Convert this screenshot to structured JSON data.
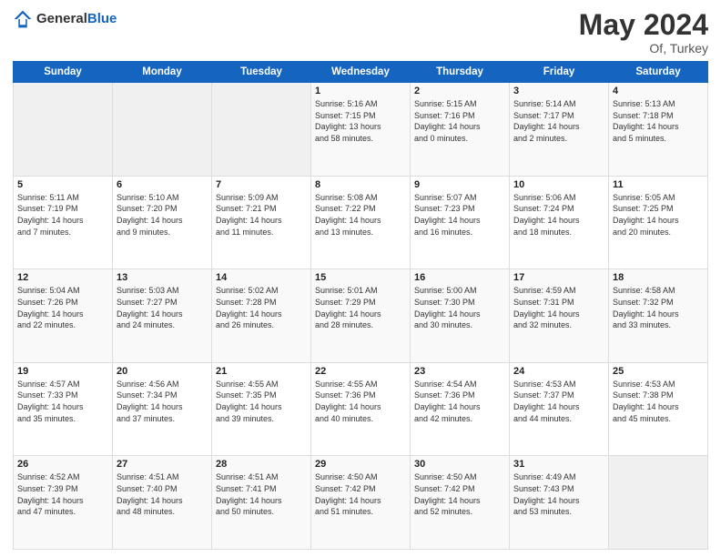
{
  "header": {
    "logo_general": "General",
    "logo_blue": "Blue",
    "month_title": "May 2024",
    "location": "Of, Turkey"
  },
  "days_of_week": [
    "Sunday",
    "Monday",
    "Tuesday",
    "Wednesday",
    "Thursday",
    "Friday",
    "Saturday"
  ],
  "weeks": [
    [
      {
        "day": "",
        "info": ""
      },
      {
        "day": "",
        "info": ""
      },
      {
        "day": "",
        "info": ""
      },
      {
        "day": "1",
        "info": "Sunrise: 5:16 AM\nSunset: 7:15 PM\nDaylight: 13 hours\nand 58 minutes."
      },
      {
        "day": "2",
        "info": "Sunrise: 5:15 AM\nSunset: 7:16 PM\nDaylight: 14 hours\nand 0 minutes."
      },
      {
        "day": "3",
        "info": "Sunrise: 5:14 AM\nSunset: 7:17 PM\nDaylight: 14 hours\nand 2 minutes."
      },
      {
        "day": "4",
        "info": "Sunrise: 5:13 AM\nSunset: 7:18 PM\nDaylight: 14 hours\nand 5 minutes."
      }
    ],
    [
      {
        "day": "5",
        "info": "Sunrise: 5:11 AM\nSunset: 7:19 PM\nDaylight: 14 hours\nand 7 minutes."
      },
      {
        "day": "6",
        "info": "Sunrise: 5:10 AM\nSunset: 7:20 PM\nDaylight: 14 hours\nand 9 minutes."
      },
      {
        "day": "7",
        "info": "Sunrise: 5:09 AM\nSunset: 7:21 PM\nDaylight: 14 hours\nand 11 minutes."
      },
      {
        "day": "8",
        "info": "Sunrise: 5:08 AM\nSunset: 7:22 PM\nDaylight: 14 hours\nand 13 minutes."
      },
      {
        "day": "9",
        "info": "Sunrise: 5:07 AM\nSunset: 7:23 PM\nDaylight: 14 hours\nand 16 minutes."
      },
      {
        "day": "10",
        "info": "Sunrise: 5:06 AM\nSunset: 7:24 PM\nDaylight: 14 hours\nand 18 minutes."
      },
      {
        "day": "11",
        "info": "Sunrise: 5:05 AM\nSunset: 7:25 PM\nDaylight: 14 hours\nand 20 minutes."
      }
    ],
    [
      {
        "day": "12",
        "info": "Sunrise: 5:04 AM\nSunset: 7:26 PM\nDaylight: 14 hours\nand 22 minutes."
      },
      {
        "day": "13",
        "info": "Sunrise: 5:03 AM\nSunset: 7:27 PM\nDaylight: 14 hours\nand 24 minutes."
      },
      {
        "day": "14",
        "info": "Sunrise: 5:02 AM\nSunset: 7:28 PM\nDaylight: 14 hours\nand 26 minutes."
      },
      {
        "day": "15",
        "info": "Sunrise: 5:01 AM\nSunset: 7:29 PM\nDaylight: 14 hours\nand 28 minutes."
      },
      {
        "day": "16",
        "info": "Sunrise: 5:00 AM\nSunset: 7:30 PM\nDaylight: 14 hours\nand 30 minutes."
      },
      {
        "day": "17",
        "info": "Sunrise: 4:59 AM\nSunset: 7:31 PM\nDaylight: 14 hours\nand 32 minutes."
      },
      {
        "day": "18",
        "info": "Sunrise: 4:58 AM\nSunset: 7:32 PM\nDaylight: 14 hours\nand 33 minutes."
      }
    ],
    [
      {
        "day": "19",
        "info": "Sunrise: 4:57 AM\nSunset: 7:33 PM\nDaylight: 14 hours\nand 35 minutes."
      },
      {
        "day": "20",
        "info": "Sunrise: 4:56 AM\nSunset: 7:34 PM\nDaylight: 14 hours\nand 37 minutes."
      },
      {
        "day": "21",
        "info": "Sunrise: 4:55 AM\nSunset: 7:35 PM\nDaylight: 14 hours\nand 39 minutes."
      },
      {
        "day": "22",
        "info": "Sunrise: 4:55 AM\nSunset: 7:36 PM\nDaylight: 14 hours\nand 40 minutes."
      },
      {
        "day": "23",
        "info": "Sunrise: 4:54 AM\nSunset: 7:36 PM\nDaylight: 14 hours\nand 42 minutes."
      },
      {
        "day": "24",
        "info": "Sunrise: 4:53 AM\nSunset: 7:37 PM\nDaylight: 14 hours\nand 44 minutes."
      },
      {
        "day": "25",
        "info": "Sunrise: 4:53 AM\nSunset: 7:38 PM\nDaylight: 14 hours\nand 45 minutes."
      }
    ],
    [
      {
        "day": "26",
        "info": "Sunrise: 4:52 AM\nSunset: 7:39 PM\nDaylight: 14 hours\nand 47 minutes."
      },
      {
        "day": "27",
        "info": "Sunrise: 4:51 AM\nSunset: 7:40 PM\nDaylight: 14 hours\nand 48 minutes."
      },
      {
        "day": "28",
        "info": "Sunrise: 4:51 AM\nSunset: 7:41 PM\nDaylight: 14 hours\nand 50 minutes."
      },
      {
        "day": "29",
        "info": "Sunrise: 4:50 AM\nSunset: 7:42 PM\nDaylight: 14 hours\nand 51 minutes."
      },
      {
        "day": "30",
        "info": "Sunrise: 4:50 AM\nSunset: 7:42 PM\nDaylight: 14 hours\nand 52 minutes."
      },
      {
        "day": "31",
        "info": "Sunrise: 4:49 AM\nSunset: 7:43 PM\nDaylight: 14 hours\nand 53 minutes."
      },
      {
        "day": "",
        "info": ""
      }
    ]
  ]
}
